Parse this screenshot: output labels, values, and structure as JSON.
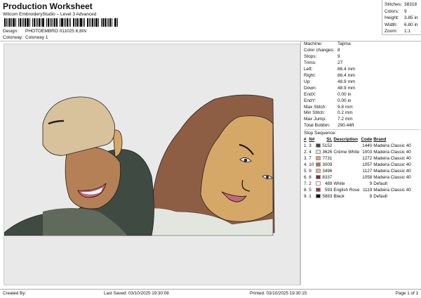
{
  "header": {
    "title": "Production Worksheet",
    "subtitle": "Wilcom EmbroideryStudio – Level 3 Advanced",
    "design_label": "Design:",
    "design_value": "PHOTOEMBRO 011025 6,8IN",
    "colorway_label": "Colorway:",
    "colorway_value": "Colorway 1"
  },
  "summary": [
    {
      "k": "Stitches:",
      "v": "38318"
    },
    {
      "k": "Colors:",
      "v": "9"
    },
    {
      "k": "Height:",
      "v": "3.85 in"
    },
    {
      "k": "Width:",
      "v": "6.80 in"
    },
    {
      "k": "Zoom:",
      "v": "1:1"
    }
  ],
  "info": [
    {
      "k": "Machine:",
      "v": "Tajima"
    },
    {
      "k": "Color changes:",
      "v": "8"
    },
    {
      "k": "Stops:",
      "v": "9"
    },
    {
      "k": "Trims:",
      "v": "27"
    },
    {
      "k": "Left:",
      "v": "86.4 mm"
    },
    {
      "k": "Right:",
      "v": "86.4 mm"
    },
    {
      "k": "Up:",
      "v": "48.9 mm"
    },
    {
      "k": "Down:",
      "v": "48.9 mm"
    },
    {
      "k": "EndX:",
      "v": "0.00 in"
    },
    {
      "k": "EndY:",
      "v": "0.00 in"
    },
    {
      "k": "Max Stitch:",
      "v": "9.8 mm"
    },
    {
      "k": "Min Stitch:",
      "v": "0.2 mm"
    },
    {
      "k": "Max Jump:",
      "v": "7.2 mm"
    },
    {
      "k": "Total Bobbin:",
      "v": "290.44ft"
    }
  ],
  "stop_sequence": {
    "title": "Stop Sequence:",
    "headers": [
      "#",
      "N#",
      "St.",
      "Description",
      "Code",
      "Brand"
    ],
    "rows": [
      {
        "i": "1.",
        "n": "3",
        "color": "#3e4843",
        "st": "5152",
        "desc": "",
        "code": "1440",
        "brand": "Madeira Classic 40"
      },
      {
        "i": "2.",
        "n": "4",
        "color": "#e4e4e0",
        "st": "3626",
        "desc": "Crème White",
        "code": "1003",
        "brand": "Madeira Classic 40"
      },
      {
        "i": "3.",
        "n": "7",
        "color": "#dba46c",
        "st": "7731",
        "desc": "",
        "code": "1272",
        "brand": "Madeira Classic 40"
      },
      {
        "i": "4.",
        "n": "10",
        "color": "#a8785a",
        "st": "3009",
        "desc": "",
        "code": "1057",
        "brand": "Madeira Classic 40"
      },
      {
        "i": "5.",
        "n": "9",
        "color": "#e2b89a",
        "st": "3496",
        "desc": "",
        "code": "1127",
        "brand": "Madeira Classic 40"
      },
      {
        "i": "6.",
        "n": "8",
        "color": "#6b3a30",
        "st": "8337",
        "desc": "",
        "code": "1058",
        "brand": "Madeira Classic 40"
      },
      {
        "i": "7.",
        "n": "2",
        "color": "#ffffff",
        "st": "489",
        "desc": "White",
        "code": "9",
        "brand": "Default"
      },
      {
        "i": "8.",
        "n": "5",
        "color": "#9a3c52",
        "st": "593",
        "desc": "English Rose",
        "code": "1119",
        "brand": "Madeira Classic 40"
      },
      {
        "i": "9.",
        "n": "1",
        "color": "#111111",
        "st": "5883",
        "desc": "Black",
        "code": "8",
        "brand": "Default"
      }
    ]
  },
  "footer": {
    "created_by": "Created By:",
    "last_saved": "Last Saved: 03/10/2025 19:30:08",
    "printed": "Printed: 03/10/2025 19:30:15",
    "page": "Page 1 of 1"
  }
}
